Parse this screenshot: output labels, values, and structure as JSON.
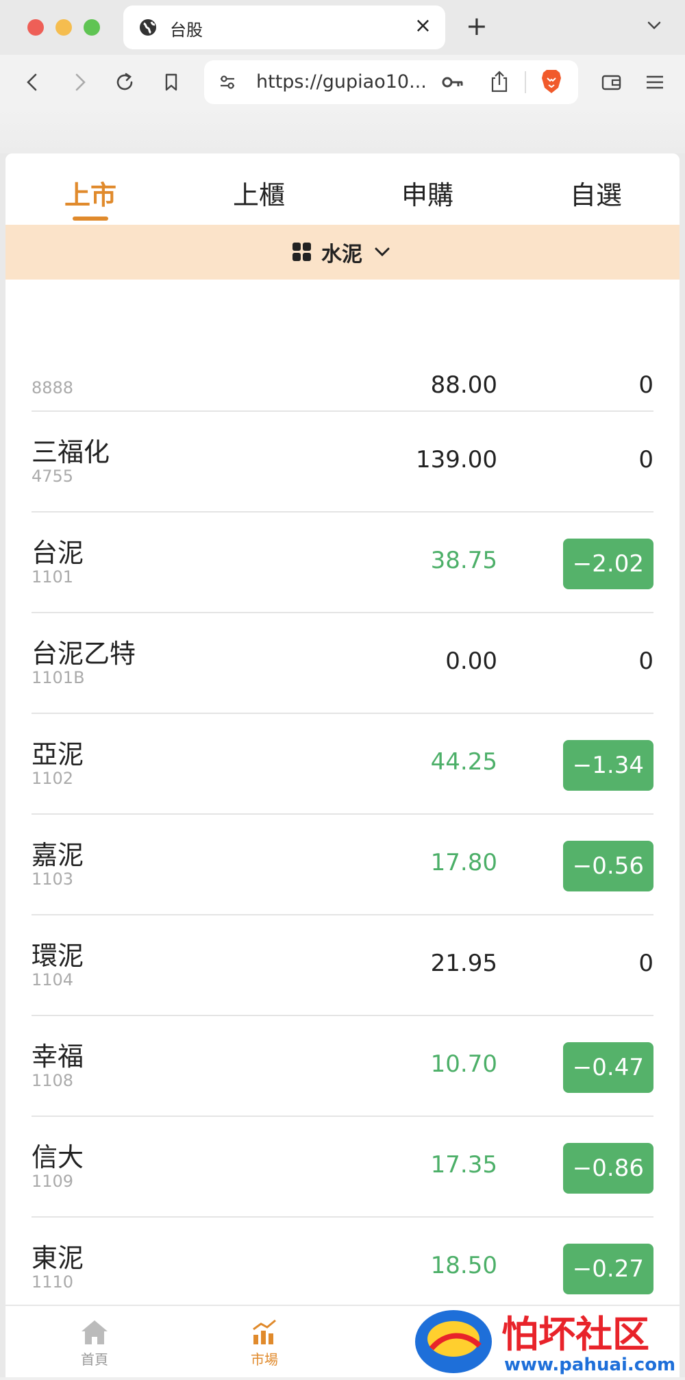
{
  "browser": {
    "tab_title": "台股",
    "url": "https://gupiao10...",
    "new_tab_label": "+",
    "close_tab_label": "×"
  },
  "market_tabs": [
    {
      "label": "上市",
      "active": true
    },
    {
      "label": "上櫃",
      "active": false
    },
    {
      "label": "申購",
      "active": false
    },
    {
      "label": "自選",
      "active": false
    }
  ],
  "category": {
    "label": "水泥"
  },
  "stocks": [
    {
      "name": "",
      "code": "8888",
      "price": "88.00",
      "change": "0",
      "trend": "flat"
    },
    {
      "name": "三福化",
      "code": "4755",
      "price": "139.00",
      "change": "0",
      "trend": "flat"
    },
    {
      "name": "台泥",
      "code": "1101",
      "price": "38.75",
      "change": "−2.02",
      "trend": "down"
    },
    {
      "name": "台泥乙特",
      "code": "1101B",
      "price": "0.00",
      "change": "0",
      "trend": "flat"
    },
    {
      "name": "亞泥",
      "code": "1102",
      "price": "44.25",
      "change": "−1.34",
      "trend": "down"
    },
    {
      "name": "嘉泥",
      "code": "1103",
      "price": "17.80",
      "change": "−0.56",
      "trend": "down"
    },
    {
      "name": "環泥",
      "code": "1104",
      "price": "21.95",
      "change": "0",
      "trend": "flat"
    },
    {
      "name": "幸福",
      "code": "1108",
      "price": "10.70",
      "change": "−0.47",
      "trend": "down"
    },
    {
      "name": "信大",
      "code": "1109",
      "price": "17.35",
      "change": "−0.86",
      "trend": "down"
    },
    {
      "name": "東泥",
      "code": "1110",
      "price": "18.50",
      "change": "−0.27",
      "trend": "down"
    }
  ],
  "bottom_nav": [
    {
      "label": "首頁",
      "icon": "home-icon",
      "active": false
    },
    {
      "label": "市場",
      "icon": "market-chart-icon",
      "active": true
    }
  ],
  "watermark": {
    "title": "怕坏社区",
    "url": "www.pahuai.com"
  },
  "colors": {
    "accent": "#e08a2c",
    "category_bg": "#fbe3c9",
    "down_green": "#4caf68",
    "badge_green": "#55b26a",
    "brave_orange": "#f15a2b"
  }
}
